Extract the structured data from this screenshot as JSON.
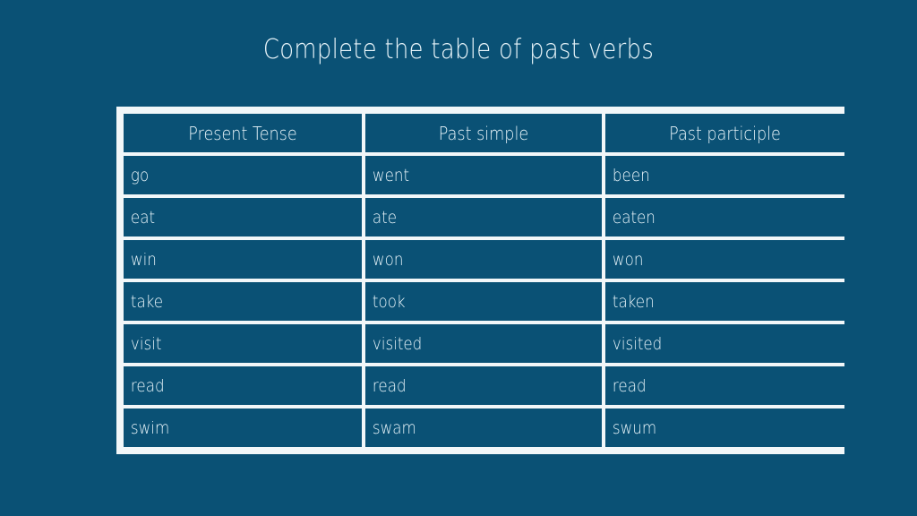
{
  "slide": {
    "title": "Complete the table of past verbs",
    "background_color": "#0a5175",
    "text_color": "#e9f5fa",
    "grid_color": "#f2f7f9"
  },
  "table": {
    "headers": [
      "Present Tense",
      "Past simple",
      "Past participle"
    ],
    "rows": [
      {
        "present": "go",
        "past_simple": "went",
        "past_participle": "been"
      },
      {
        "present": "eat",
        "past_simple": "ate",
        "past_participle": "eaten"
      },
      {
        "present": "win",
        "past_simple": "won",
        "past_participle": "won"
      },
      {
        "present": "take",
        "past_simple": "took",
        "past_participle": "taken"
      },
      {
        "present": "visit",
        "past_simple": "visited",
        "past_participle": "visited"
      },
      {
        "present": "read",
        "past_simple": "read",
        "past_participle": "read"
      },
      {
        "present": "swim",
        "past_simple": "swam",
        "past_participle": "swum"
      }
    ]
  }
}
